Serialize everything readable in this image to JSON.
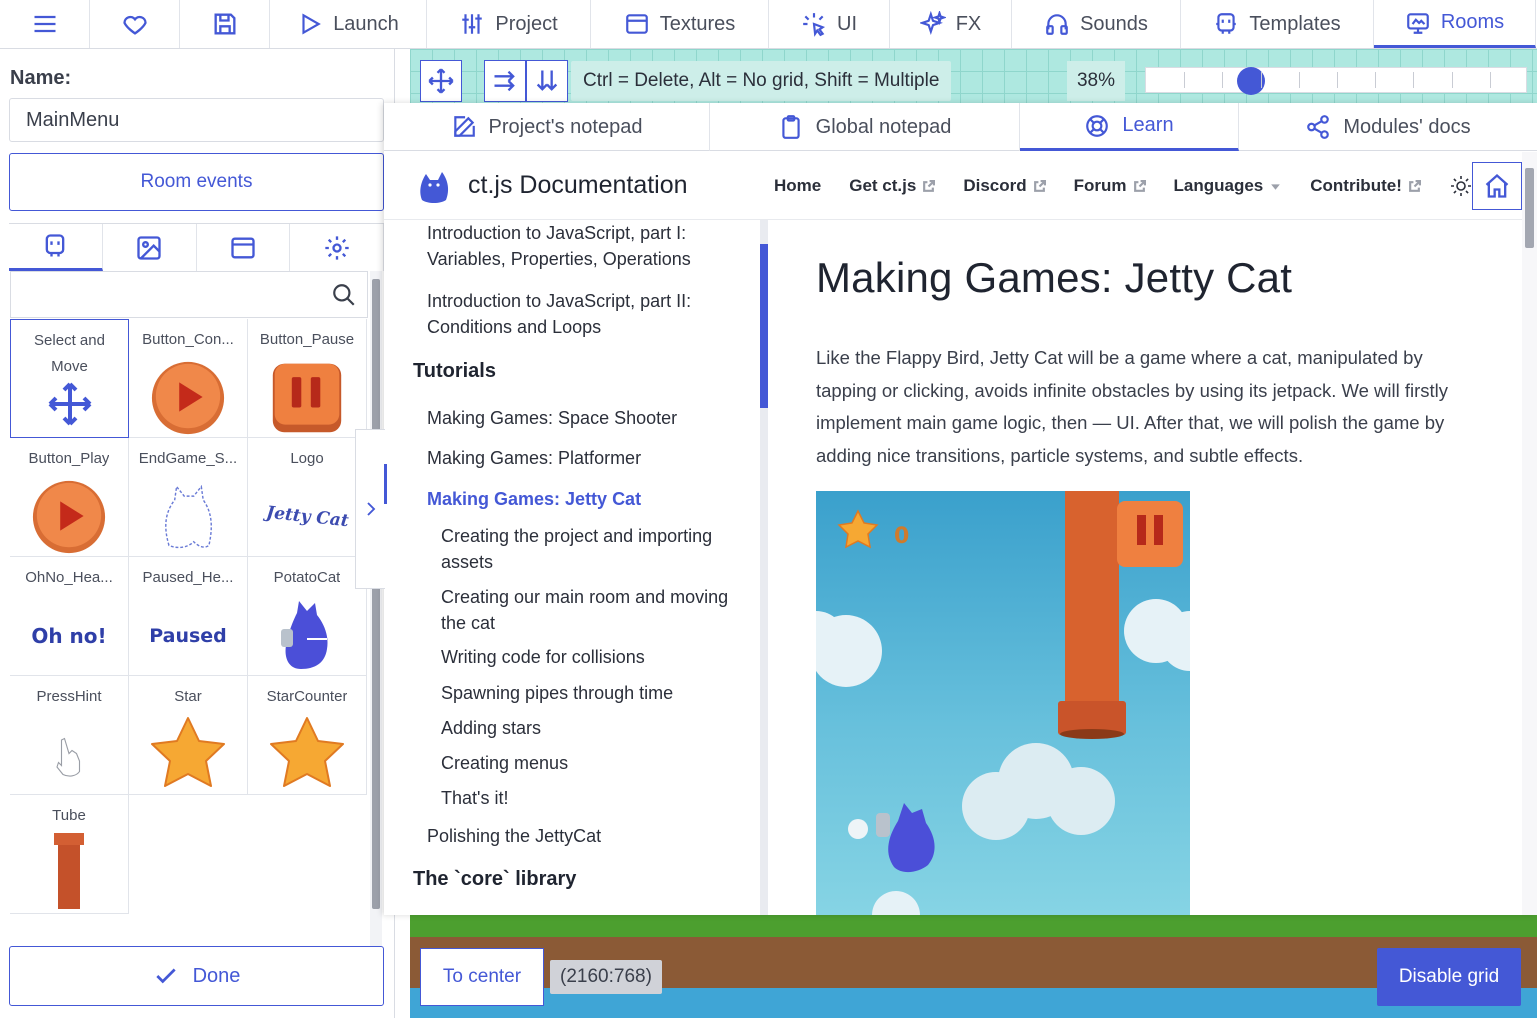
{
  "topbar": {
    "tabs": [
      {
        "label": "Launch",
        "icon": "play-icon"
      },
      {
        "label": "Project",
        "icon": "sliders-icon"
      },
      {
        "label": "Textures",
        "icon": "texture-icon"
      },
      {
        "label": "UI",
        "icon": "sparkle-pointer-icon"
      },
      {
        "label": "FX",
        "icon": "fx-sparkles-icon"
      },
      {
        "label": "Sounds",
        "icon": "headphones-icon"
      },
      {
        "label": "Templates",
        "icon": "template-icon"
      },
      {
        "label": "Rooms",
        "icon": "rooms-icon"
      }
    ],
    "active": "Rooms"
  },
  "left": {
    "name_label": "Name:",
    "name_value": "MainMenu",
    "room_events": "Room events",
    "done": "Done",
    "assets": [
      {
        "label": "Select and Move"
      },
      {
        "label": "Button_Con..."
      },
      {
        "label": "Button_Pause"
      },
      {
        "label": "Button_Play"
      },
      {
        "label": "EndGame_S..."
      },
      {
        "label": "Logo",
        "art_text": "Jetty Cat"
      },
      {
        "label": "OhNo_Hea...",
        "art_text": "Oh no!"
      },
      {
        "label": "Paused_He...",
        "art_text": "Paused"
      },
      {
        "label": "PotatoCat"
      },
      {
        "label": "PressHint"
      },
      {
        "label": "Star"
      },
      {
        "label": "StarCounter"
      },
      {
        "label": "Tube"
      }
    ]
  },
  "room": {
    "hint": "Ctrl = Delete, Alt = No grid, Shift = Multiple",
    "zoom": "38%",
    "zoom_fraction": 0.27,
    "to_center": "To center",
    "coords": "(2160:768)",
    "disable_grid": "Disable grid"
  },
  "docs": {
    "tabs": [
      {
        "label": "Project's notepad"
      },
      {
        "label": "Global notepad"
      },
      {
        "label": "Learn"
      },
      {
        "label": "Modules' docs"
      }
    ],
    "active_tab": "Learn",
    "site_title": "ct.js Documentation",
    "nav": [
      "Home",
      "Get ct.js",
      "Discord",
      "Forum",
      "Languages",
      "Contribute!"
    ],
    "sidebar": {
      "intro1": "Introduction to JavaScript, part I: Variables, Properties, Operations",
      "intro2": "Introduction to JavaScript, part II: Conditions and Loops",
      "tutorials": "Tutorials",
      "t1": "Making Games: Space Shooter",
      "t2": "Making Games: Platformer",
      "t3": "Making Games: Jetty Cat",
      "s1": "Creating the project and importing assets",
      "s2": "Creating our main room and moving the cat",
      "s3": "Writing code for collisions",
      "s4": "Spawning pipes through time",
      "s5": "Adding stars",
      "s6": "Creating menus",
      "s7": "That's it!",
      "t4": "Polishing the JettyCat",
      "core": "The `core` library"
    },
    "article": {
      "title": "Making Games: Jetty Cat",
      "body": "Like the Flappy Bird, Jetty Cat will be a game where a cat, manipulated by tapping or clicking, avoids infinite obstacles by using its jetpack. We will firstly implement main game logic, then — UI. After that, we will polish the game by adding nice transitions, particle systems, and subtle effects.",
      "score": "0"
    }
  },
  "colors": {
    "accent": "#4458d6",
    "canvas_bg": "#aee8e0",
    "grass": "#4c9f2f"
  }
}
